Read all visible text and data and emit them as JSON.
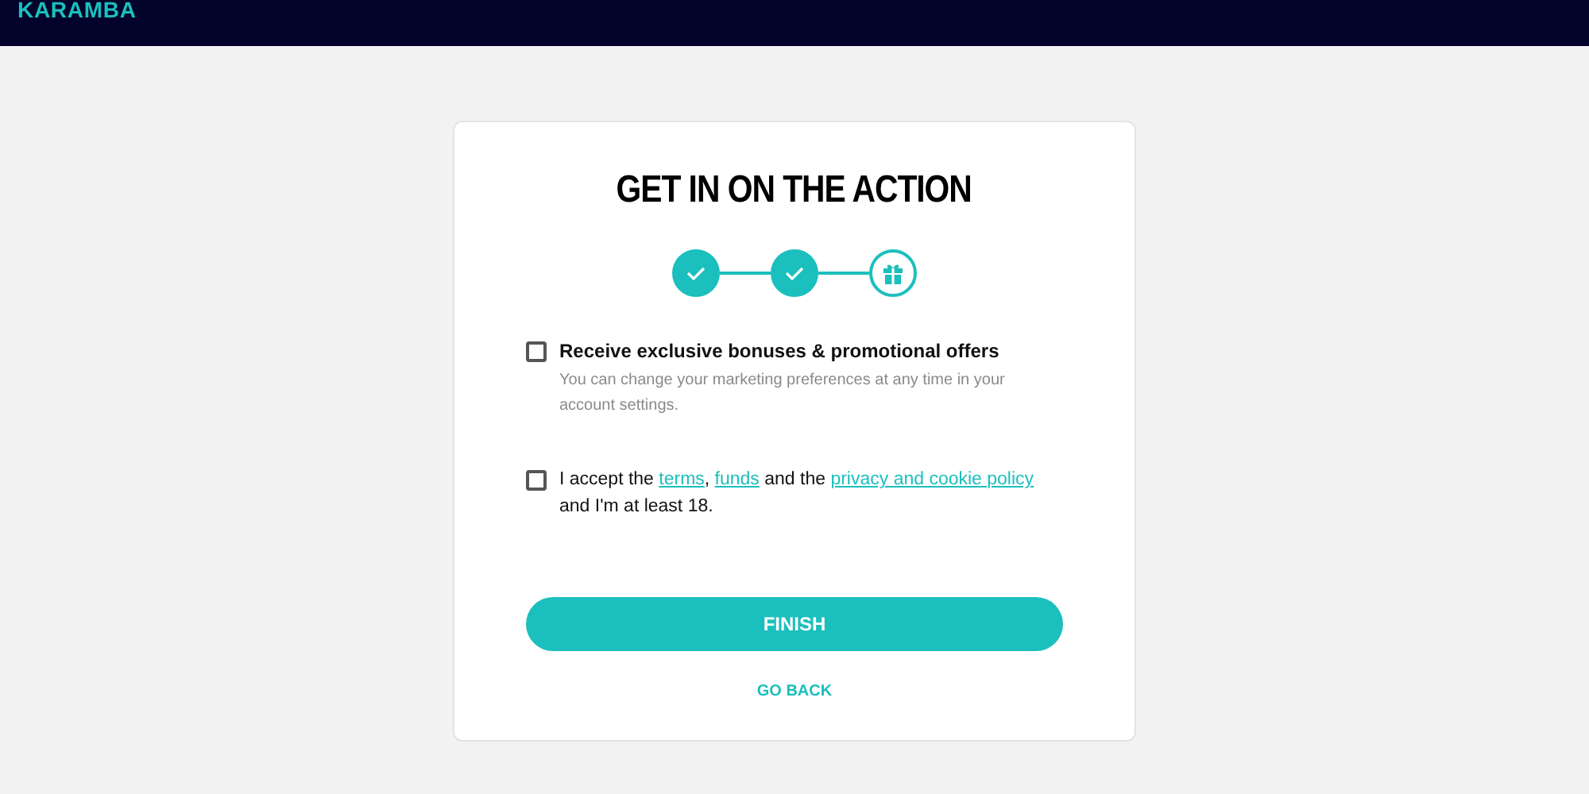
{
  "header": {
    "logo": "KARAMBA"
  },
  "form": {
    "title": "GET IN ON THE ACTION",
    "steps": [
      {
        "completed": true
      },
      {
        "completed": true
      },
      {
        "completed": false
      }
    ],
    "options": [
      {
        "checked": false,
        "label": "Receive exclusive bonuses & promotional offers",
        "hint": "You can change your marketing preferences at any time in your account settings."
      },
      {
        "checked": false,
        "parts": [
          {
            "kind": "text",
            "text": "I accept the "
          },
          {
            "kind": "link",
            "text": "terms"
          },
          {
            "kind": "text",
            "text": ", "
          },
          {
            "kind": "link",
            "text": "funds"
          },
          {
            "kind": "text",
            "text": " and the "
          },
          {
            "kind": "link",
            "text": "privacy and cookie policy"
          },
          {
            "kind": "text",
            "text": " and I'm at least 18."
          }
        ]
      }
    ],
    "submit": "FINISH",
    "back": "GO BACK"
  }
}
